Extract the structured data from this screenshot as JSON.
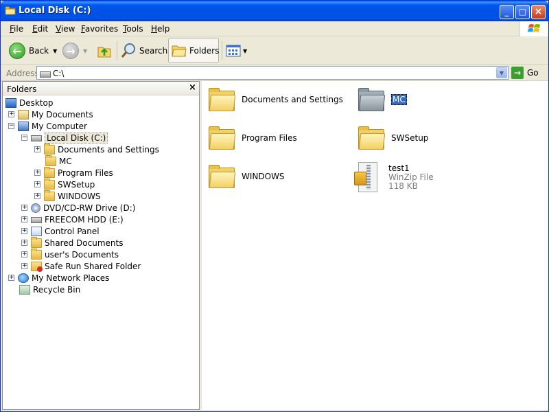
{
  "window": {
    "title": "Local Disk (C:)"
  },
  "menu": [
    {
      "label": "File"
    },
    {
      "label": "Edit"
    },
    {
      "label": "View"
    },
    {
      "label": "Favorites"
    },
    {
      "label": "Tools"
    },
    {
      "label": "Help"
    }
  ],
  "toolbar": {
    "back_label": "Back",
    "search_label": "Search",
    "folders_label": "Folders"
  },
  "address": {
    "label": "Address",
    "value": "C:\\",
    "go_label": "Go"
  },
  "folders_pane": {
    "title": "Folders",
    "close_glyph": "×",
    "tree": [
      {
        "label": "Desktop"
      },
      {
        "label": "My Documents"
      },
      {
        "label": "My Computer"
      },
      {
        "label": "Local Disk (C:)"
      },
      {
        "label": "Documents and Settings"
      },
      {
        "label": "MC"
      },
      {
        "label": "Program Files"
      },
      {
        "label": "SWSetup"
      },
      {
        "label": "WINDOWS"
      },
      {
        "label": "DVD/CD-RW Drive (D:)"
      },
      {
        "label": "FREECOM HDD (E:)"
      },
      {
        "label": "Control Panel"
      },
      {
        "label": "Shared Documents"
      },
      {
        "label": "user's Documents"
      },
      {
        "label": "Safe Run Shared Folder"
      },
      {
        "label": "My Network Places"
      },
      {
        "label": "Recycle Bin"
      }
    ]
  },
  "content": {
    "items": [
      {
        "name": "Documents and Settings"
      },
      {
        "name": "MC"
      },
      {
        "name": "Program Files"
      },
      {
        "name": "SWSetup"
      },
      {
        "name": "WINDOWS"
      },
      {
        "name": "test1",
        "type": "WinZip File",
        "size": "118 KB"
      }
    ]
  },
  "colors": {
    "titlebar": "#0054e8",
    "selection": "#316ac5",
    "chrome": "#ece9d8"
  }
}
